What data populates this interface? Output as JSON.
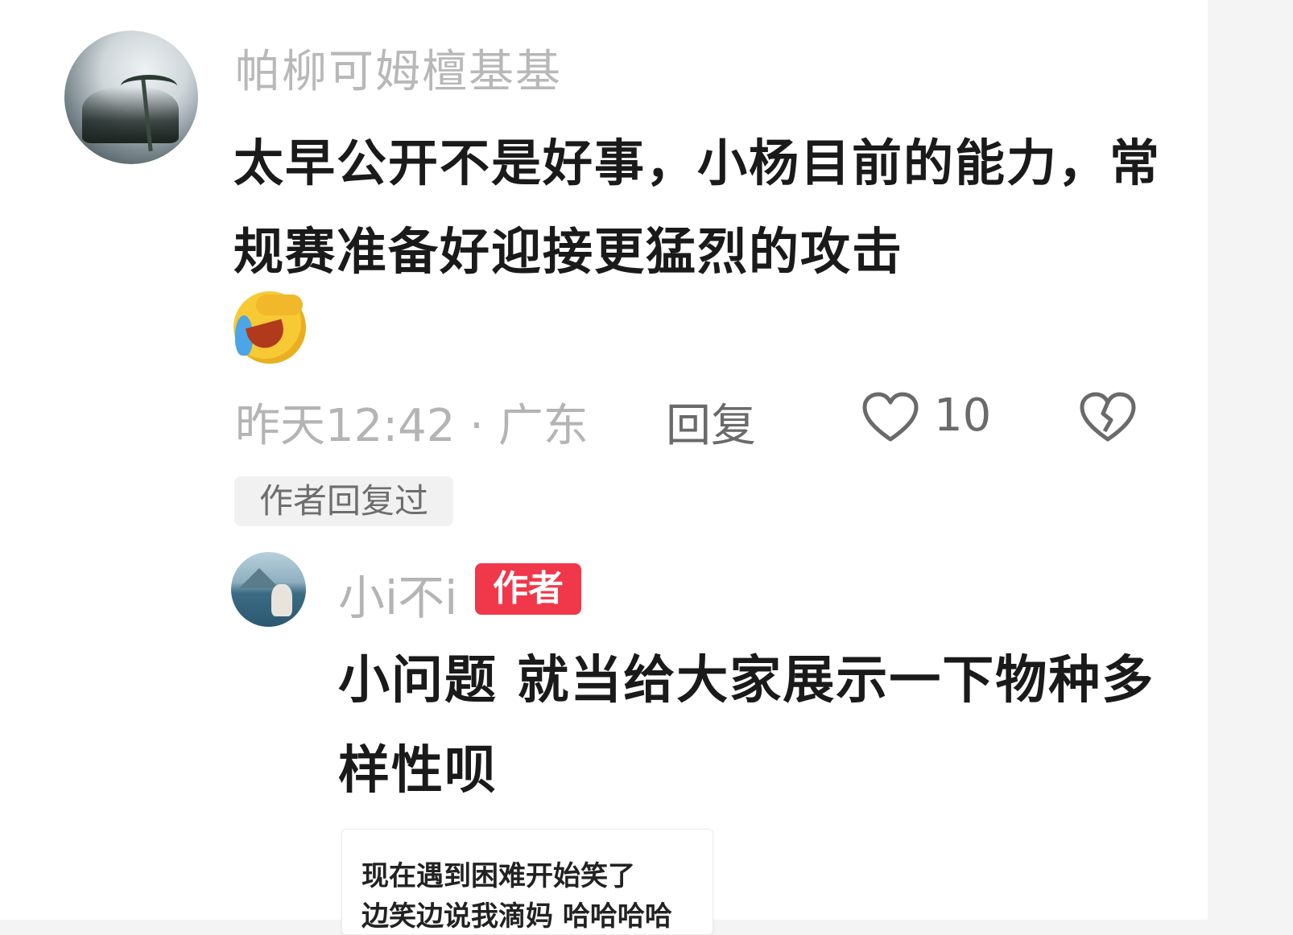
{
  "comment": {
    "username": "帕柳可姆檀基基",
    "text": "太早公开不是好事，小杨目前的能力，常规赛准备好迎接更猛烈的攻击",
    "emoji": "laughing-crying-emoji",
    "time_location": "昨天12:42 · 广东",
    "reply_label": "回复",
    "like_count": "10",
    "author_replied_label": "作者回复过"
  },
  "reply": {
    "username": "小i不i",
    "badge": "作者",
    "text": "小问题 就当给大家展示一下物种多样性呗",
    "badge_color": "#f0384a"
  },
  "quote_card": {
    "line1": "现在遇到困难开始笑了",
    "line2": "边笑边说我滴妈 哈哈哈哈"
  }
}
